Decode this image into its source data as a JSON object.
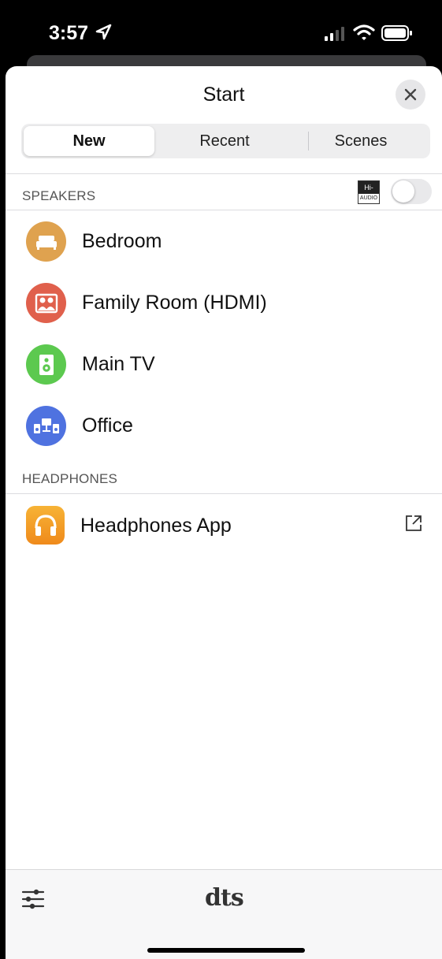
{
  "status_bar": {
    "time": "3:57"
  },
  "sheet": {
    "title": "Start"
  },
  "tabs": [
    {
      "label": "New",
      "active": true
    },
    {
      "label": "Recent",
      "active": false
    },
    {
      "label": "Scenes",
      "active": false
    }
  ],
  "speakers_section": {
    "header": "SPEAKERS",
    "hires_badge": {
      "top": "Hi-Res",
      "bottom": "AUDIO"
    },
    "hires_toggle_on": false,
    "items": [
      {
        "label": "Bedroom",
        "icon": "bed-icon",
        "color": "#dfa24f"
      },
      {
        "label": "Family Room (HDMI)",
        "icon": "family-room-icon",
        "color": "#e0604c"
      },
      {
        "label": "Main TV",
        "icon": "speaker-icon",
        "color": "#5cc94f"
      },
      {
        "label": "Office",
        "icon": "office-speakers-icon",
        "color": "#4f72e0"
      }
    ]
  },
  "headphones_section": {
    "header": "HEADPHONES",
    "items": [
      {
        "label": "Headphones App",
        "icon": "headphones-icon",
        "external": true
      }
    ]
  },
  "bottom_bar": {
    "logo": "dts"
  }
}
